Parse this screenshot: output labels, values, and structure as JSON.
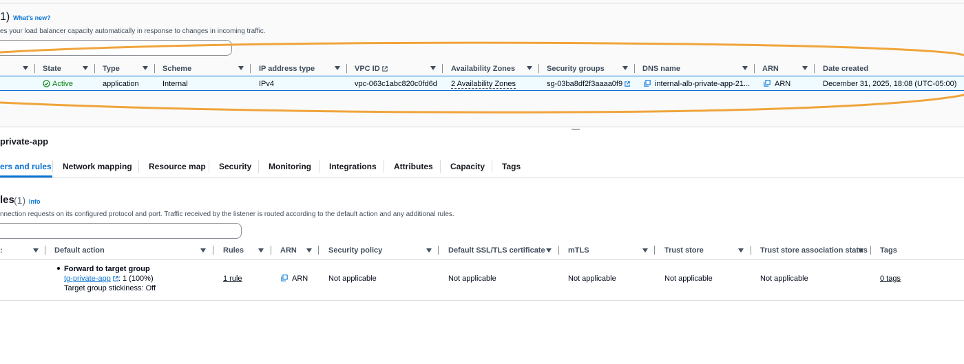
{
  "lb_list": {
    "title_count": "1)",
    "whats_new": "What's new?",
    "description": "es your load balancer capacity automatically in response to changes in incoming traffic.",
    "columns": [
      "State",
      "Type",
      "Scheme",
      "IP address type",
      "VPC ID",
      "Availability Zones",
      "Security groups",
      "DNS name",
      "ARN",
      "Date created"
    ],
    "row": {
      "state": "Active",
      "type": "application",
      "scheme": "Internal",
      "ip_address_type": "IPv4",
      "vpc_id": "vpc-063c1abc820c0fd6d",
      "availability_zones": "2 Availability Zones",
      "security_groups": "sg-03ba8df2f3aaaa0f9",
      "dns_name": "internal-alb-private-app-21...",
      "arn": "ARN",
      "date_created": "December 31, 2025, 18:08 (UTC-05:00)"
    }
  },
  "resize_handle": "—",
  "details": {
    "name": "private-app",
    "tabs": [
      "ers and rules",
      "Network mapping",
      "Resource map",
      "Security",
      "Monitoring",
      "Integrations",
      "Attributes",
      "Capacity",
      "Tags"
    ]
  },
  "listeners": {
    "title": "les",
    "count": "(1)",
    "info": "Info",
    "description": "nnection requests on its configured protocol and port. Traffic received by the listener is routed according to the default action and any additional rules.",
    "first_col_fragment": ":",
    "columns": [
      "Default action",
      "Rules",
      "ARN",
      "Security policy",
      "Default SSL/TLS certificate",
      "mTLS",
      "Trust store",
      "Trust store association status",
      "Tags"
    ],
    "row": {
      "action_title": "Forward to target group",
      "target_group": "tg-private-app",
      "target_weight": ": 1 (100%)",
      "stickiness": "Target group stickiness: Off",
      "rules": "1 rule",
      "arn": "ARN",
      "security_policy": "Not applicable",
      "ssl_certificate": "Not applicable",
      "mtls": "Not applicable",
      "trust_store": "Not applicable",
      "trust_store_status": "Not applicable",
      "tags": "0 tags"
    }
  },
  "colors": {
    "accent": "#0972d3",
    "success": "#037f0c",
    "annotation": "#f0a43a",
    "selected_row": "#f0fbff",
    "selected_border": "#0972d3"
  },
  "icons": [
    "sort-caret-icon",
    "status-check-icon",
    "external-link-icon",
    "copy-icon"
  ]
}
